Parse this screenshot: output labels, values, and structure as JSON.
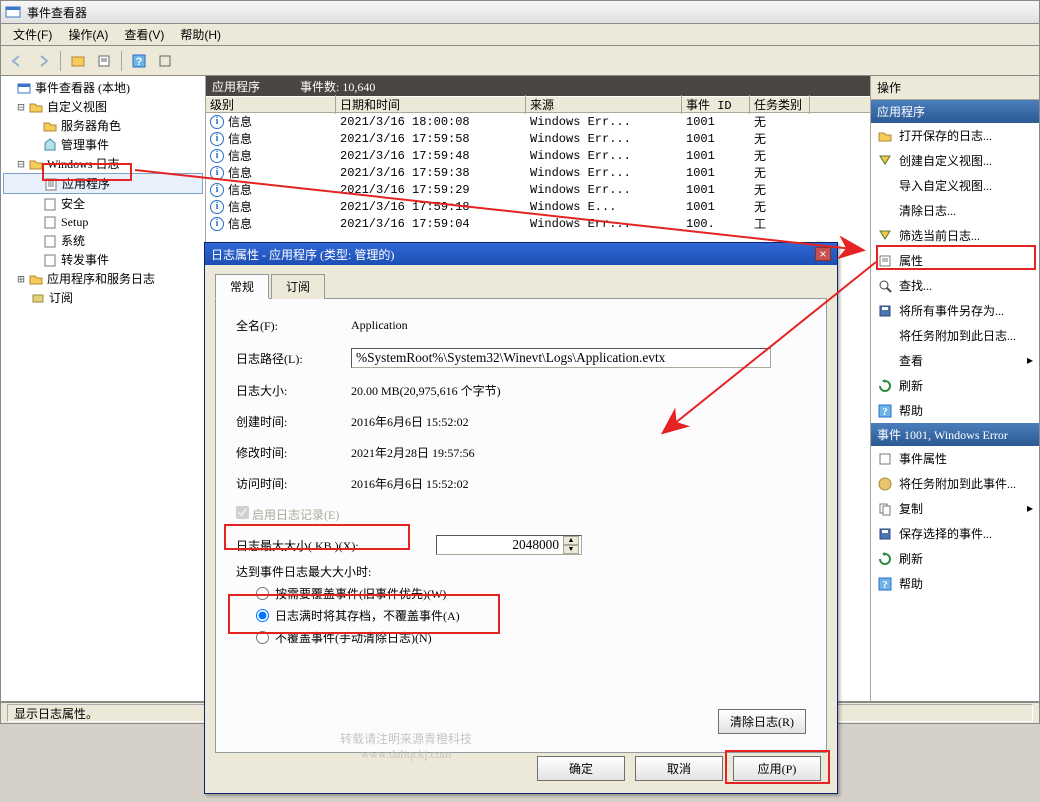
{
  "window": {
    "title": "事件查看器"
  },
  "menu": {
    "file": "文件(F)",
    "action": "操作(A)",
    "view": "查看(V)",
    "help": "帮助(H)"
  },
  "tree": {
    "root": "事件查看器 (本地)",
    "custom_views": "自定义视图",
    "server_roles": "服务器角色",
    "admin_events": "管理事件",
    "windows_logs": "Windows 日志",
    "app": "应用程序",
    "security": "安全",
    "setup": "Setup",
    "system": "系统",
    "forwarded": "转发事件",
    "app_service_logs": "应用程序和服务日志",
    "subscriptions": "订阅"
  },
  "list": {
    "header_title": "应用程序",
    "count_label": "事件数: 10,640",
    "cols": {
      "level": "级别",
      "datetime": "日期和时间",
      "source": "来源",
      "event_id": "事件 ID",
      "category": "任务类别"
    },
    "info_label": "信息",
    "rows": [
      {
        "dt": "2021/3/16 18:00:08",
        "src": "Windows Err...",
        "id": "1001",
        "cat": "无"
      },
      {
        "dt": "2021/3/16 17:59:58",
        "src": "Windows Err...",
        "id": "1001",
        "cat": "无"
      },
      {
        "dt": "2021/3/16 17:59:48",
        "src": "Windows Err...",
        "id": "1001",
        "cat": "无"
      },
      {
        "dt": "2021/3/16 17:59:38",
        "src": "Windows Err...",
        "id": "1001",
        "cat": "无"
      },
      {
        "dt": "2021/3/16 17:59:29",
        "src": "Windows Err...",
        "id": "1001",
        "cat": "无"
      },
      {
        "dt": "2021/3/16 17:59:18",
        "src": "Windows E...",
        "id": "1001",
        "cat": "无"
      },
      {
        "dt": "2021/3/16 17:59:04",
        "src": "Windows Err...",
        "id": "100.",
        "cat": "工"
      }
    ]
  },
  "actions": {
    "title": "操作",
    "section1": "应用程序",
    "open_saved": "打开保存的日志...",
    "create_custom": "创建自定义视图...",
    "import_custom": "导入自定义视图...",
    "clear_log": "清除日志...",
    "filter_current": "筛选当前日志...",
    "properties": "属性",
    "find": "查找...",
    "save_all": "将所有事件另存为...",
    "attach_task": "将任务附加到此日志...",
    "view": "查看",
    "refresh": "刷新",
    "help": "帮助",
    "section2": "事件 1001, Windows Error",
    "event_props": "事件属性",
    "attach_task2": "将任务附加到此事件...",
    "copy": "复制",
    "save_selected": "保存选择的事件...",
    "refresh2": "刷新",
    "help2": "帮助"
  },
  "status": "显示日志属性。",
  "dialog": {
    "title": "日志属性 - 应用程序 (类型: 管理的)",
    "tab_general": "常规",
    "tab_subscribe": "订阅",
    "full_name_label": "全名(F):",
    "full_name": "Application",
    "log_path_label": "日志路径(L):",
    "log_path": "%SystemRoot%\\System32\\Winevt\\Logs\\Application.evtx",
    "log_size_label": "日志大小:",
    "log_size": "20.00 MB(20,975,616 个字节)",
    "created_label": "创建时间:",
    "created": "2016年6月6日 15:52:02",
    "modified_label": "修改时间:",
    "modified": "2021年2月28日 19:57:56",
    "accessed_label": "访问时间:",
    "accessed": "2016年6月6日 15:52:02",
    "enable_logging": "启用日志记录(E)",
    "max_size_label": "日志最大大小( KB )(X):",
    "max_size_value": "2048000",
    "when_max_label": "达到事件日志最大大小时:",
    "opt_overwrite": "按需要覆盖事件(旧事件优先)(W)",
    "opt_archive": "日志满时将其存档，不覆盖事件(A)",
    "opt_no_overwrite": "不覆盖事件(手动清除日志)(N)",
    "btn_clear": "清除日志(R)",
    "btn_ok": "确定",
    "btn_cancel": "取消",
    "btn_apply": "应用(P)"
  },
  "watermark": {
    "line1": "转载请注明来源青橙科技",
    "line2": "www.daliqckj.com"
  }
}
